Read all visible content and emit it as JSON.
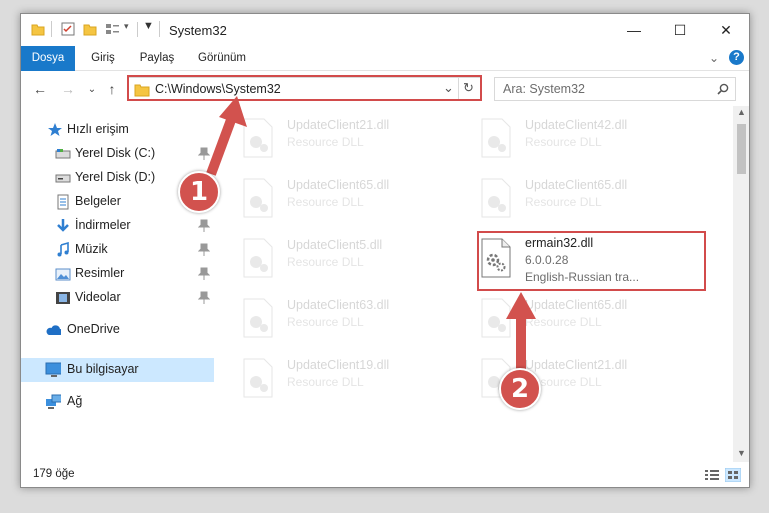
{
  "window": {
    "title": "System32",
    "controls": {
      "minimize": "—",
      "maximize": "☐",
      "close": "✕"
    }
  },
  "ribbon": {
    "tabs": [
      "Dosya",
      "Giriş",
      "Paylaş",
      "Görünüm"
    ]
  },
  "address": {
    "path": "C:\\Windows\\System32",
    "search_placeholder": "Ara: System32"
  },
  "sidebar": {
    "items": [
      {
        "label": "Hızlı erişim",
        "icon": "star-icon"
      },
      {
        "label": "Yerel Disk (C:)",
        "icon": "drive-icon",
        "pinned": true
      },
      {
        "label": "Yerel Disk (D:)",
        "icon": "drive-icon"
      },
      {
        "label": "Belgeler",
        "icon": "documents-icon"
      },
      {
        "label": "İndirmeler",
        "icon": "download-icon",
        "pinned": true
      },
      {
        "label": "Müzik",
        "icon": "music-icon",
        "pinned": true
      },
      {
        "label": "Resimler",
        "icon": "pictures-icon",
        "pinned": true
      },
      {
        "label": "Videolar",
        "icon": "videos-icon",
        "pinned": true
      },
      {
        "label": "OneDrive",
        "icon": "cloud-icon"
      },
      {
        "label": "Bu bilgisayar",
        "icon": "computer-icon",
        "selected": true
      },
      {
        "label": "Ağ",
        "icon": "network-icon"
      }
    ]
  },
  "files": [
    {
      "name": "UpdateClient21.dll",
      "sub": "Resource DLL"
    },
    {
      "name": "UpdateClient42.dll",
      "sub": "Resource DLL"
    },
    {
      "name": "UpdateClient65.dll",
      "sub": "Resource DLL"
    },
    {
      "name": "UpdateClient65.dll",
      "sub": "Resource DLL"
    },
    {
      "name": "UpdateClient5.dll",
      "sub": "Resource DLL"
    },
    {
      "name": "ermain32.dll",
      "version": "6.0.0.28",
      "description": "English-Russian tra...",
      "highlighted": true
    },
    {
      "name": "UpdateClient63.dll",
      "sub": "Resource DLL"
    },
    {
      "name": "UpdateClient65.dll",
      "sub": "Resource DLL"
    },
    {
      "name": "UpdateClient19.dll",
      "sub": "Resource DLL"
    },
    {
      "name": "UpdateClient21.dll",
      "sub": "Resource DLL"
    }
  ],
  "status": {
    "item_count": "179 öğe"
  },
  "annotations": {
    "step1": "1",
    "step2": "2",
    "color": "#d2524e"
  }
}
